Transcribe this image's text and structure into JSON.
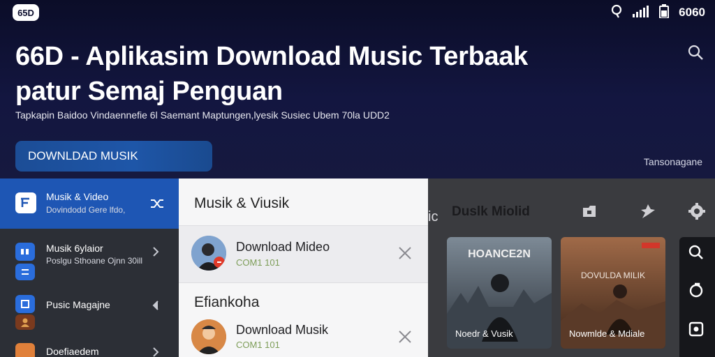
{
  "status_bar": {
    "app_badge": "65D",
    "time": "6060"
  },
  "hero": {
    "title_line1": "66D - Aplikasim Download Music Terbaak",
    "title_line2": "patur Semaj Penguan",
    "subtitle": "Tapkapin Baidoo Vindaennefie 6l Saemant Maptungen,lyesik Susiec Ubem 70la UDD2",
    "download_button": "DOWNLDAD MUSIK",
    "right_link": "Tansonagane"
  },
  "sidebar": {
    "items": [
      {
        "title": "Musik & Video",
        "subtitle": "Dovindodd Gere lfdo,",
        "icon": "video-icon"
      },
      {
        "title": "Musik 6ylaior",
        "subtitle": "Poslgu Sthoane Ojnn 30ill",
        "icon": "music-icon"
      },
      {
        "title": "Pusic Magajne",
        "subtitle": "",
        "icon": "magazine-icon"
      },
      {
        "title": "Doefiaedem",
        "subtitle": "",
        "icon": "document-icon"
      }
    ]
  },
  "dialog": {
    "title": "Musik & Viusik",
    "section_title": "Efiankoha",
    "rows": [
      {
        "label": "Download Mideo",
        "count": "COM1 101"
      },
      {
        "label": "Download Musik",
        "count": "COM1 101"
      }
    ]
  },
  "right_panel": {
    "edge_label": "ic",
    "title": "Duslk Miolid",
    "cards": [
      {
        "top_text": "HOANCE2N",
        "caption": "Noedr & Vusik"
      },
      {
        "top_text": "DOVULDA MILIK",
        "caption": "Nowmlde & Mdiale"
      }
    ]
  },
  "colors": {
    "accent_blue": "#1e56b4",
    "hero_bg": "#0d0f2e",
    "count_green": "#7d9d58"
  }
}
